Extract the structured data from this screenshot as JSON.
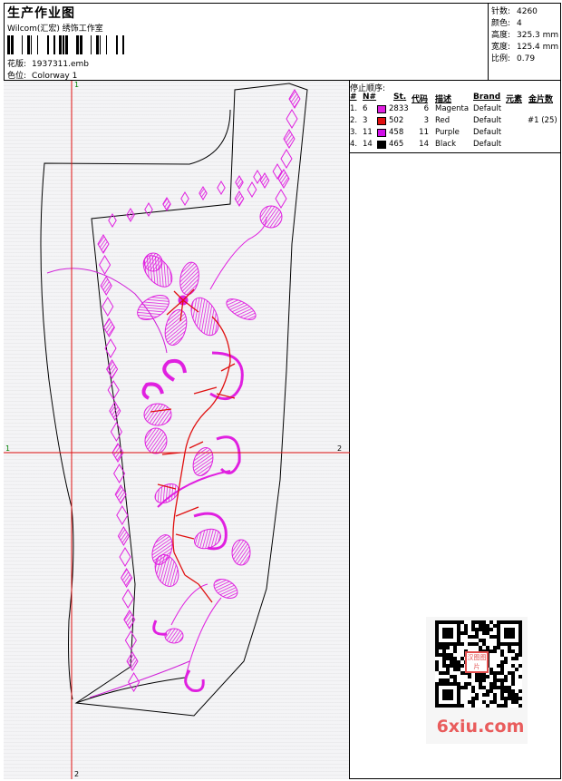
{
  "header": {
    "title": "生产作业图",
    "company": "Wilcom(汇宏) 绣饰工作室",
    "design_label": "花版:",
    "design_value": "1937311.emb",
    "colorway_label": "色位:",
    "colorway_value": "Colorway 1"
  },
  "stats": [
    {
      "label": "针数:",
      "value": "4260"
    },
    {
      "label": "颜色:",
      "value": "4"
    },
    {
      "label": "高度:",
      "value": "325.3 mm"
    },
    {
      "label": "宽度:",
      "value": "125.4 mm"
    },
    {
      "label": "比例:",
      "value": "0.79"
    }
  ],
  "stop_sequence": {
    "title": "停止顺序:",
    "columns": [
      "#",
      "N#",
      "St.",
      "代码",
      "描述",
      "Brand",
      "元素",
      "金片数"
    ],
    "rows": [
      {
        "num": "1.",
        "n": "6",
        "color": "#e020e0",
        "stitches": "2833",
        "code": "6",
        "desc": "Magenta",
        "brand": "Default",
        "sequin": ""
      },
      {
        "num": "2.",
        "n": "3",
        "color": "#e01010",
        "stitches": "502",
        "code": "3",
        "desc": "Red",
        "brand": "Default",
        "sequin": "#1 (25)"
      },
      {
        "num": "3.",
        "n": "11",
        "color": "#d010e8",
        "stitches": "458",
        "code": "11",
        "desc": "Purple",
        "brand": "Default",
        "sequin": ""
      },
      {
        "num": "4.",
        "n": "14",
        "color": "#000000",
        "stitches": "465",
        "code": "14",
        "desc": "Black",
        "brand": "Default",
        "sequin": ""
      }
    ]
  },
  "axes": {
    "h_left": "1",
    "h_right": "2",
    "v_top": "1",
    "v_bottom": "2"
  },
  "watermark": {
    "text": "6xiu.com",
    "seal": "汉图图片"
  }
}
